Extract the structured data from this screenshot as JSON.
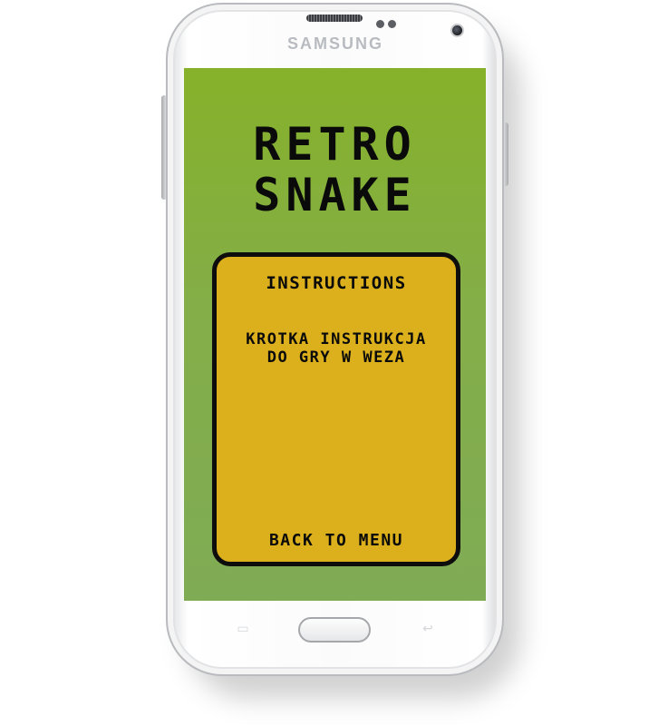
{
  "device": {
    "brand": "SAMSUNG",
    "body_color": "#ffffff",
    "screen_color": "#84ae48",
    "panel_color": "#dbb01c"
  },
  "game": {
    "title_line1": "RETRO",
    "title_line2": "SNAKE",
    "panel": {
      "heading": "INSTRUCTIONS",
      "text": "KROTKA INSTRUKCJA DO GRY W WEZA",
      "back_label": "BACK TO MENU"
    }
  },
  "icons": {
    "recent_apps": "recent-apps-icon",
    "back": "back-icon"
  }
}
